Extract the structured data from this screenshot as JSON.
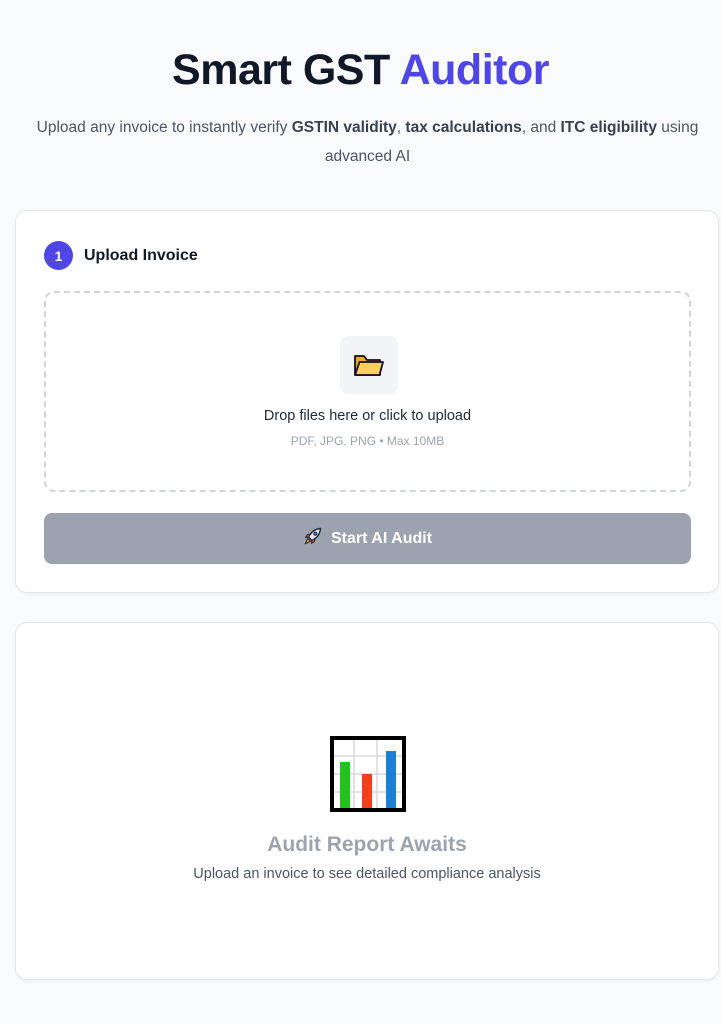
{
  "header": {
    "title_main": "Smart GST ",
    "title_accent": "Auditor",
    "subtitle": {
      "p1": "Upload any invoice to instantly verify ",
      "b1": "GSTIN validity",
      "p2": ", ",
      "b2": "tax calculations",
      "p3": ", and ",
      "b3": "ITC eligibility",
      "p4": " using advanced AI"
    }
  },
  "upload": {
    "step_number": "1",
    "step_label": "Upload Invoice",
    "dropzone": {
      "icon": "folder-icon",
      "title": "Drop files here or click to upload",
      "hint": "PDF, JPG, PNG • Max 10MB"
    },
    "button": {
      "icon": "rocket-icon",
      "label": "Start AI Audit",
      "disabled": true
    }
  },
  "report": {
    "icon": "bar-chart-icon",
    "title": "Audit Report Awaits",
    "subtitle": "Upload an invoice to see detailed compliance analysis"
  },
  "colors": {
    "accent": "#4f46e5",
    "button_disabled": "#9ca3af",
    "background": "#f9fafb"
  }
}
